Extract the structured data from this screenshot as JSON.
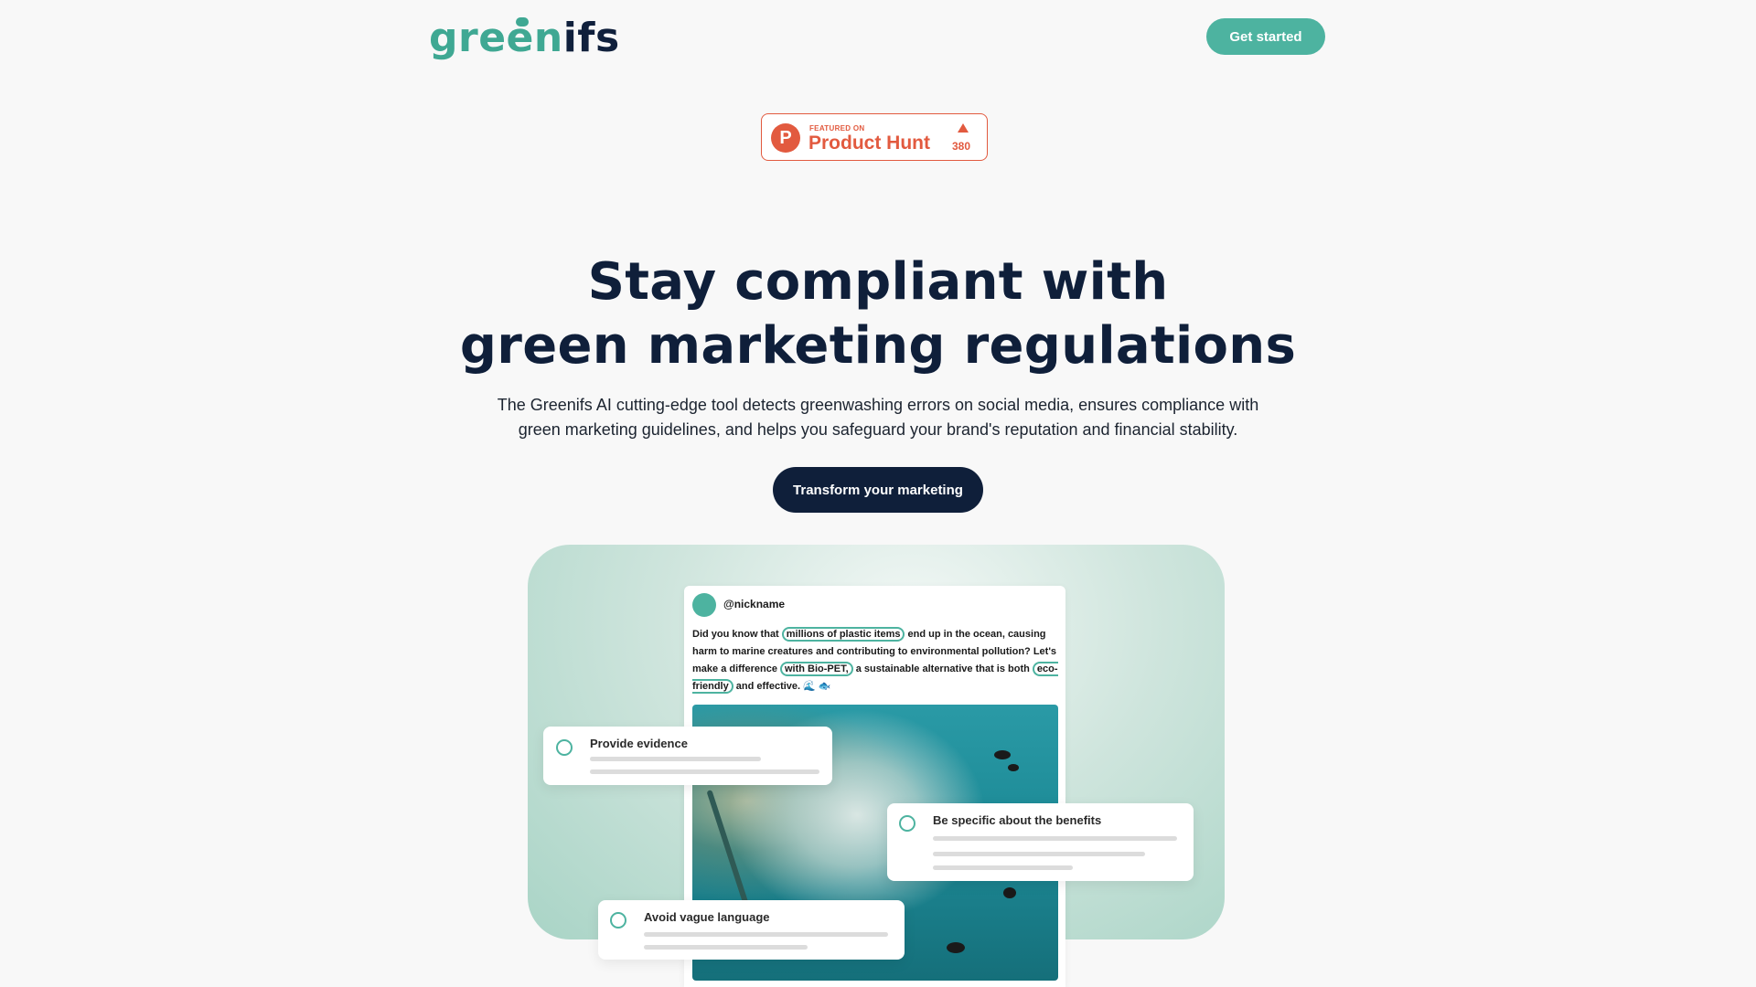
{
  "header": {
    "logo_green": "green",
    "logo_dark": "ifs",
    "logo_i": "i",
    "logo_prefix": "gree",
    "logo_n": "n",
    "get_started_label": "Get started"
  },
  "badge": {
    "featured_label": "FEATURED ON",
    "name": "Product Hunt",
    "icon_letter": "P",
    "upvotes": "380"
  },
  "hero": {
    "headline_line1": "Stay compliant with",
    "headline_line2": "green marketing regulations",
    "subtitle": "The Greenifs AI cutting-edge tool detects greenwashing errors on social media, ensures compliance with green marketing guidelines, and helps you safeguard your brand's reputation and financial stability.",
    "cta_label": "Transform your marketing"
  },
  "post": {
    "nickname": "@nickname",
    "text_1": "Did you know that ",
    "hl_1": "millions of plastic items",
    "text_2": " end up in the ocean, causing harm to marine creatures and contributing to environmental pollution? Let's make a difference ",
    "hl_2": "with Bio-PET,",
    "text_3": " a sustainable alternative that is both ",
    "hl_3": "eco-friendly",
    "text_4": " and effective. 🌊 🐟"
  },
  "cards": {
    "evidence": "Provide evidence",
    "specific": "Be specific about the benefits",
    "vague": "Avoid vague language"
  },
  "colors": {
    "brand_green": "#4db3a0",
    "navy": "#0f1f3a",
    "product_hunt": "#e25a3f"
  }
}
